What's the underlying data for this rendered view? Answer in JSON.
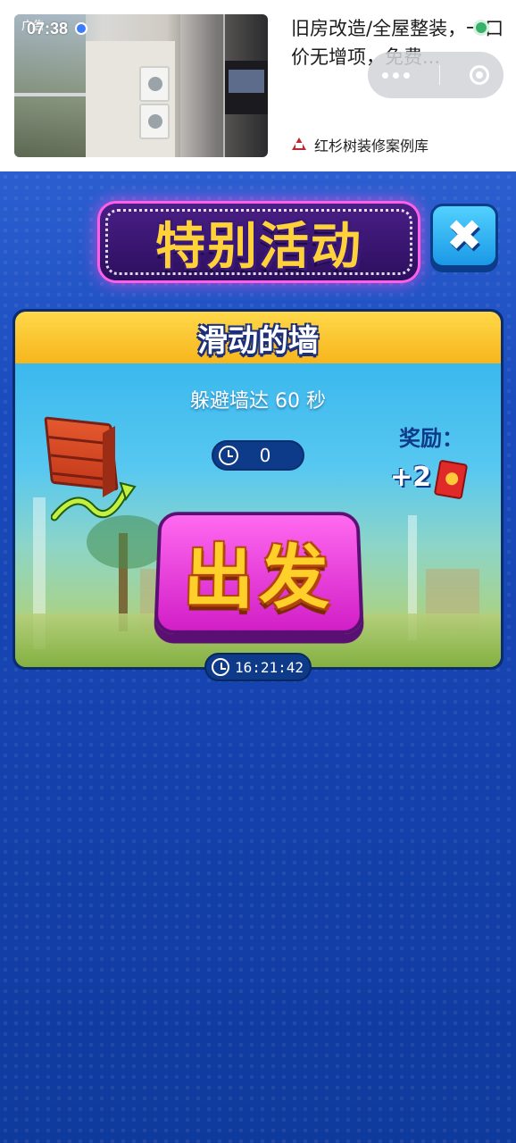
{
  "ad": {
    "label": "广告",
    "status_time": "07:38",
    "title": "旧房改造/全屋整装，一口价无增项，免费...",
    "source": "红杉树装修案例库"
  },
  "game": {
    "title": "特别活动",
    "close_icon": "close-icon",
    "event": {
      "name": "滑动的墙",
      "goal": "躲避墙达 60 秒",
      "timer_value": "0",
      "reward_label": "奖励：",
      "reward_value": "+2",
      "go_label": "出发",
      "countdown": "16:21:42"
    }
  }
}
